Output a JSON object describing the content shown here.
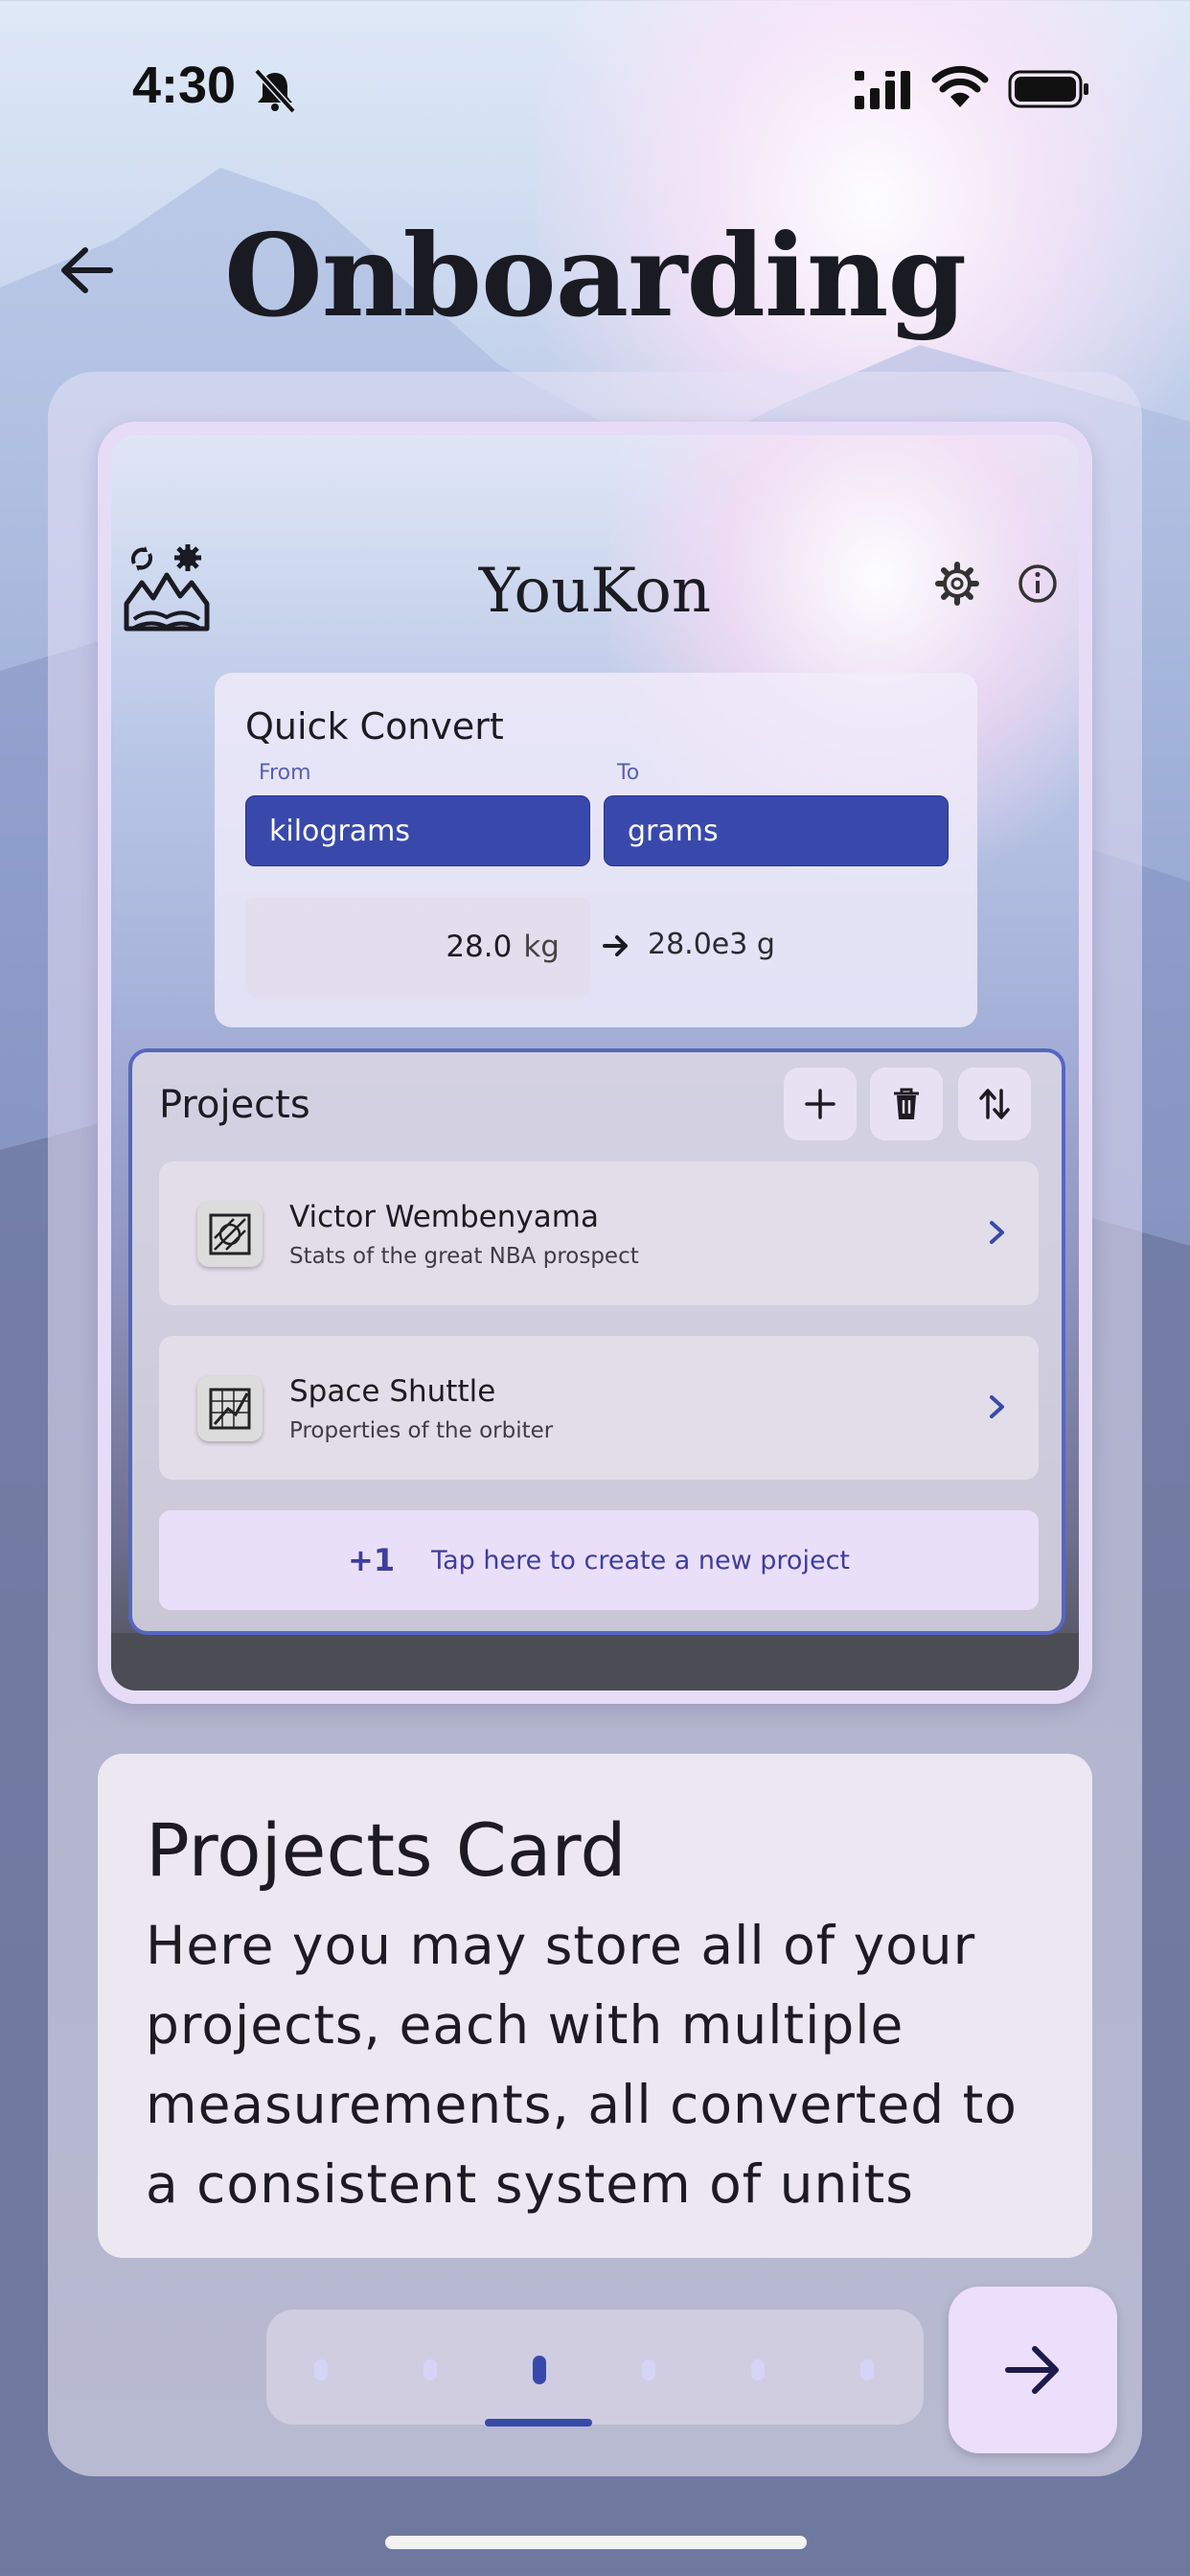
{
  "status_bar": {
    "time": "4:30",
    "icons": [
      "bell-off-icon",
      "signal-icon",
      "wifi-icon",
      "battery-icon"
    ]
  },
  "header": {
    "title": "Onboarding",
    "back_icon": "arrow-left-icon"
  },
  "preview": {
    "app_name": "YouKon",
    "icons": [
      "logo-mountains-icon",
      "settings-icon",
      "info-icon"
    ],
    "quick_convert": {
      "title": "Quick Convert",
      "from_label": "From",
      "to_label": "To",
      "from_unit": "kilograms",
      "to_unit": "grams",
      "input_value": "28.0",
      "input_unit": "kg",
      "result": "28.0e3 g"
    },
    "projects": {
      "title": "Projects",
      "actions": [
        "add-icon",
        "trash-icon",
        "sort-icon"
      ],
      "items": [
        {
          "name": "Victor Wembenyama",
          "description": "Stats of the great NBA prospect",
          "icon": "project-drawing-icon"
        },
        {
          "name": "Space Shuttle",
          "description": "Properties of the orbiter",
          "icon": "project-chart-icon"
        }
      ],
      "new_project": {
        "plus": "+1",
        "label": "Tap here to create a new project"
      }
    }
  },
  "description": {
    "title": "Projects Card",
    "body": "Here you may store all of your projects, each with multiple measurements, all converted to a consistent system of units"
  },
  "pager": {
    "total_pages": 6,
    "current_page": 3,
    "next_icon": "arrow-right-icon"
  },
  "colors": {
    "accent": "#3949ab",
    "button_bg": "#ecdffb",
    "new_project_text": "#3f3d9e"
  }
}
